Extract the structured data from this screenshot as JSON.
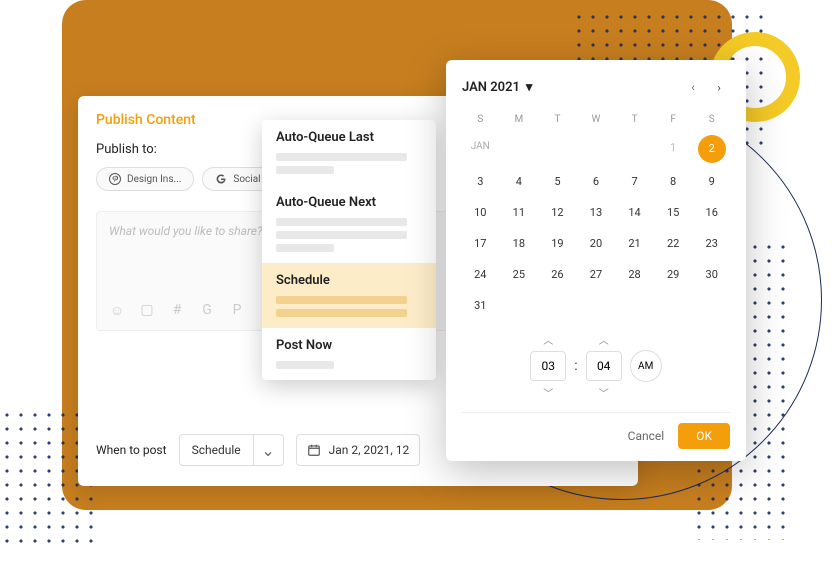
{
  "panel": {
    "title": "Publish Content",
    "publish_to_label": "Publish to:",
    "chips": [
      {
        "label": "Design Ins...",
        "icon": "pinterest-icon"
      },
      {
        "label": "Social Cha...",
        "icon": "google-icon"
      }
    ],
    "composer_placeholder": "What would you like to share? Sta",
    "when_label": "When to post",
    "schedule_value": "Schedule",
    "date_value": "Jan 2, 2021, 12"
  },
  "queue": {
    "items": [
      {
        "label": "Auto-Queue Last",
        "selected": false
      },
      {
        "label": "Auto-Queue Next",
        "selected": false
      },
      {
        "label": "Schedule",
        "selected": true
      },
      {
        "label": "Post Now",
        "selected": false
      }
    ]
  },
  "calendar": {
    "title": "JAN 2021",
    "month_abbr": "JAN",
    "dow": [
      "S",
      "M",
      "T",
      "W",
      "T",
      "F",
      "S"
    ],
    "leading_muted": [
      "1"
    ],
    "selected_day": "2",
    "days": [
      "3",
      "4",
      "5",
      "6",
      "7",
      "8",
      "9",
      "10",
      "11",
      "12",
      "13",
      "14",
      "15",
      "16",
      "17",
      "18",
      "19",
      "20",
      "21",
      "22",
      "23",
      "24",
      "25",
      "26",
      "27",
      "28",
      "29",
      "30",
      "31"
    ],
    "time": {
      "hour": "03",
      "minute": "04",
      "ampm": "AM"
    },
    "cancel": "Cancel",
    "ok": "OK"
  }
}
